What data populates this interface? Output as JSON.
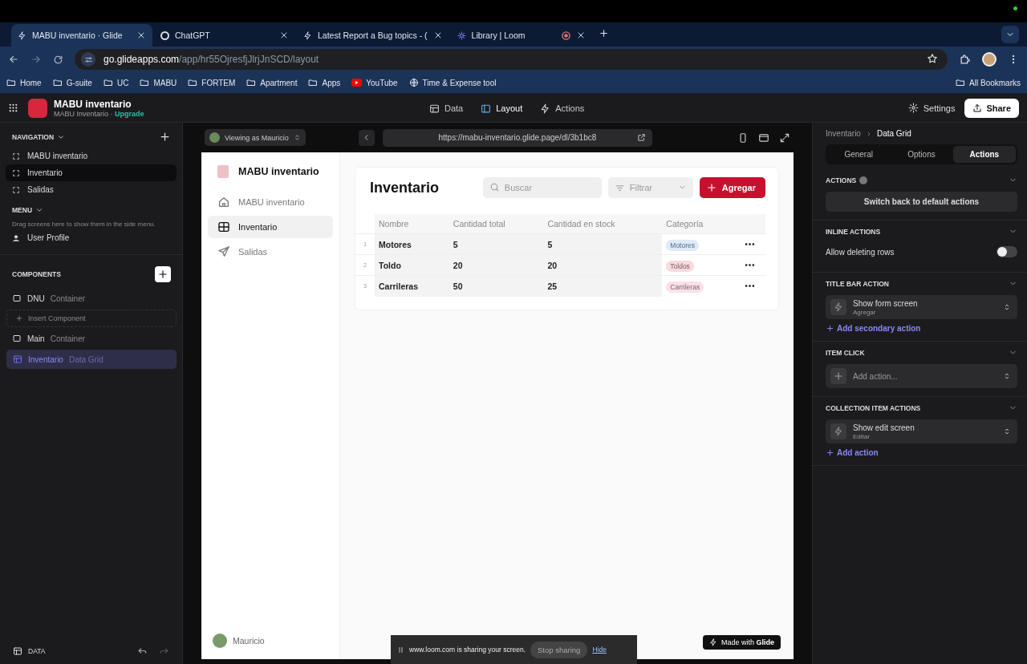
{
  "browser": {
    "tabs": [
      {
        "title": "MABU inventario · Glide",
        "selected": true,
        "recording": false
      },
      {
        "title": "ChatGPT",
        "selected": false,
        "recording": false
      },
      {
        "title": "Latest Report a Bug topics - (",
        "selected": false,
        "recording": false
      },
      {
        "title": "Library | Loom",
        "selected": false,
        "recording": true
      }
    ],
    "url_host": "go.glideapps.com",
    "url_path": "/app/hr55OjresfjJlrjJnSCD/layout",
    "bookmarks": [
      {
        "label": "Home",
        "kind": "folder"
      },
      {
        "label": "G-suite",
        "kind": "folder"
      },
      {
        "label": "UC",
        "kind": "folder"
      },
      {
        "label": "MABU",
        "kind": "folder"
      },
      {
        "label": "FORTEM",
        "kind": "folder"
      },
      {
        "label": "Apartment",
        "kind": "folder"
      },
      {
        "label": "Apps",
        "kind": "folder"
      },
      {
        "label": "YouTube",
        "kind": "video"
      },
      {
        "label": "Time & Expense tool",
        "kind": "site"
      }
    ],
    "all_bookmarks": "All Bookmarks"
  },
  "header": {
    "app_name": "MABU inventario",
    "subtitle": "MABU Inventario ·",
    "upgrade": "Upgrade",
    "tabs": [
      {
        "label": "Data",
        "selected": false
      },
      {
        "label": "Layout",
        "selected": true
      },
      {
        "label": "Actions",
        "selected": false
      }
    ],
    "settings": "Settings",
    "share": "Share"
  },
  "sidebar": {
    "navigation_title": "NAVIGATION",
    "navigation": [
      {
        "label": "MABU inventario",
        "selected": false
      },
      {
        "label": "Inventario",
        "selected": true
      },
      {
        "label": "Salidas",
        "selected": false
      }
    ],
    "menu_title": "MENU",
    "menu_hint": "Drag screens here to show them in the side menu.",
    "menu_items": [
      {
        "label": "User Profile"
      }
    ],
    "components_title": "COMPONENTS",
    "components": [
      {
        "name": "DNU",
        "type": "Container",
        "selected": false,
        "insert": "Insert Component"
      },
      {
        "name": "Main",
        "type": "Container",
        "selected": false,
        "children": [
          {
            "name": "Inventario",
            "type": "Data Grid",
            "selected": true
          }
        ]
      }
    ],
    "data_label": "DATA"
  },
  "preview": {
    "viewing_as": "Viewing as Mauricio",
    "url": "https://mabu-inventario.glide.page/dl/3b1bc8",
    "app": {
      "title": "MABU inventario",
      "nav": [
        {
          "label": "MABU inventario",
          "selected": false
        },
        {
          "label": "Inventario",
          "selected": true
        },
        {
          "label": "Salidas",
          "selected": false
        }
      ],
      "user": "Mauricio",
      "grid": {
        "title": "Inventario",
        "search_placeholder": "Buscar",
        "filter": "Filtrar",
        "add": "Agregar",
        "columns": [
          "Nombre",
          "Cantidad total",
          "Cantidad en stock",
          "Categoría"
        ],
        "rows": [
          {
            "number": "1",
            "cells": [
              "Motores",
              "5",
              "5"
            ],
            "tag": "Motores",
            "color": "#dcebfb"
          },
          {
            "number": "2",
            "cells": [
              "Toldo",
              "20",
              "20"
            ],
            "tag": "Toldos",
            "color": "#f9dadd"
          },
          {
            "number": "3",
            "cells": [
              "Carrileras",
              "50",
              "25"
            ],
            "tag": "Carrileras",
            "color": "#fbe0ea"
          }
        ]
      },
      "badge": "Made with **Glide**"
    },
    "share_bar": {
      "message": "www.loom.com is sharing your screen.",
      "stop": "Stop sharing",
      "hide": "Hide"
    }
  },
  "panel": {
    "breadcrumb": [
      "Inventario",
      "Data Grid"
    ],
    "tabs": [
      {
        "label": "General",
        "selected": false
      },
      {
        "label": "Options",
        "selected": false
      },
      {
        "label": "Actions",
        "selected": true
      }
    ],
    "sections": [
      {
        "title": "ACTIONS",
        "info": true,
        "items": [
          {
            "kind": "button",
            "label": "Switch back to default actions"
          }
        ]
      },
      {
        "title": "INLINE ACTIONS",
        "info": false,
        "items": [
          {
            "kind": "toggle",
            "label": "Allow deleting rows",
            "on": false
          }
        ]
      },
      {
        "title": "TITLE BAR ACTION",
        "info": false,
        "items": [
          {
            "kind": "action",
            "label": "Show form screen",
            "sublabel": "Agregar"
          },
          {
            "kind": "link",
            "label": "Add secondary action"
          }
        ]
      },
      {
        "title": "ITEM CLICK",
        "info": false,
        "items": [
          {
            "kind": "add",
            "label": "Add action..."
          }
        ]
      },
      {
        "title": "COLLECTION ITEM ACTIONS",
        "info": false,
        "items": [
          {
            "kind": "action",
            "label": "Show edit screen",
            "sublabel": "Editar"
          },
          {
            "kind": "link",
            "label": "Add action"
          }
        ]
      }
    ]
  }
}
